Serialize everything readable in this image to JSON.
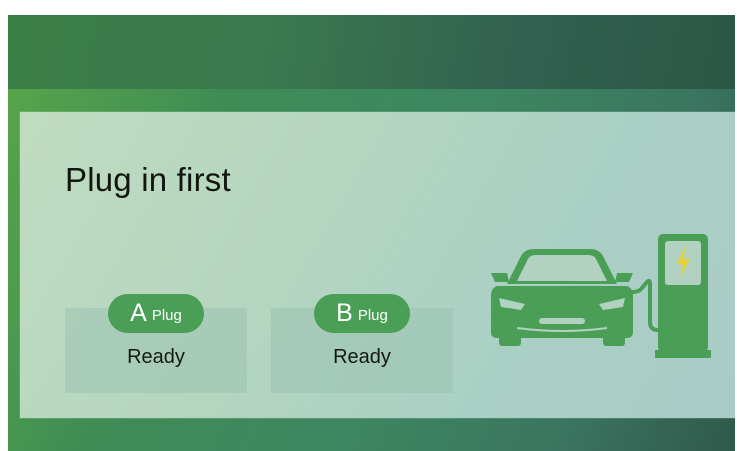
{
  "screen": {
    "title": "Plug in first"
  },
  "plugs": [
    {
      "letter": "A",
      "word": "Plug",
      "status": "Ready"
    },
    {
      "letter": "B",
      "word": "Plug",
      "status": "Ready"
    }
  ],
  "colors": {
    "accent": "#4a9e56",
    "illustration": "#4a9e56",
    "bolt": "#e3d13a"
  },
  "icons": {
    "illustration": "car-charging-station-icon"
  }
}
